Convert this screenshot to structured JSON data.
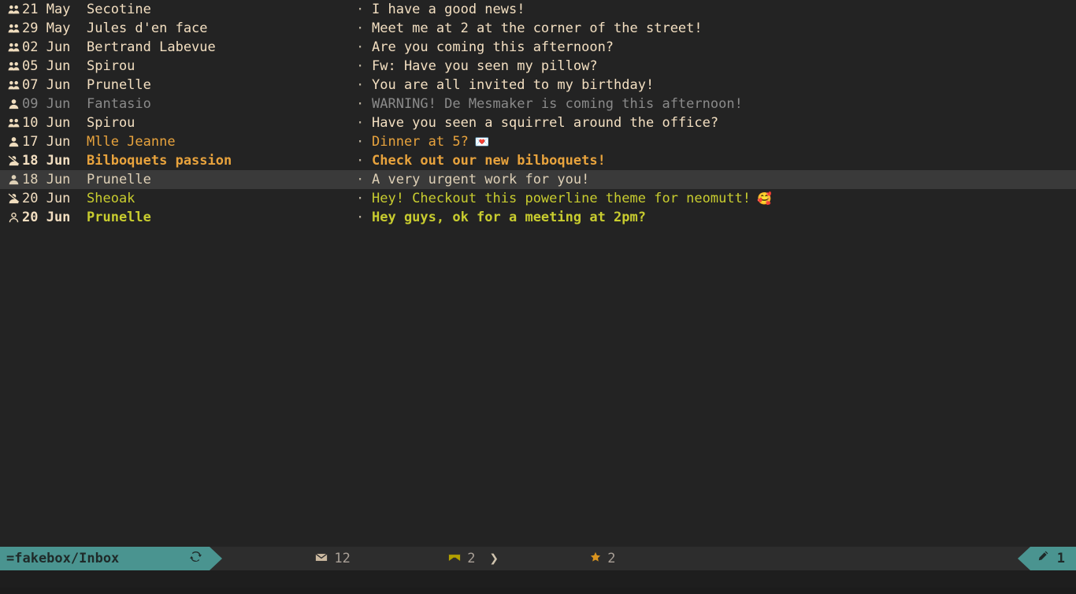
{
  "index": {
    "separator": "·",
    "rows": [
      {
        "flag_icon": "group-icon",
        "date": "21 May",
        "sender": "Secotine",
        "subject": "I have a good news!",
        "emoji": "",
        "style": "default",
        "selected": false
      },
      {
        "flag_icon": "group-icon",
        "date": "29 May",
        "sender": "Jules d'en face",
        "subject": "Meet me at 2 at the corner of the street!",
        "emoji": "",
        "style": "default",
        "selected": false
      },
      {
        "flag_icon": "group-icon",
        "date": "02 Jun",
        "sender": "Bertrand Labevue",
        "subject": "Are you coming this afternoon?",
        "emoji": "",
        "style": "default",
        "selected": false
      },
      {
        "flag_icon": "group-icon",
        "date": "05 Jun",
        "sender": "Spirou",
        "subject": "Fw: Have you seen my pillow?",
        "emoji": "",
        "style": "default",
        "selected": false
      },
      {
        "flag_icon": "group-icon",
        "date": "07 Jun",
        "sender": "Prunelle",
        "subject": "You are all invited to my birthday!",
        "emoji": "",
        "style": "default",
        "selected": false
      },
      {
        "flag_icon": "person-icon",
        "date": "09 Jun",
        "sender": "Fantasio",
        "subject": "WARNING! De Mesmaker is coming this afternoon!",
        "emoji": "",
        "style": "dim",
        "selected": false
      },
      {
        "flag_icon": "group-icon",
        "date": "10 Jun",
        "sender": "Spirou",
        "subject": "Have you seen a squirrel around the office?",
        "emoji": "",
        "style": "default",
        "selected": false
      },
      {
        "flag_icon": "person-icon",
        "date": "17 Jun",
        "sender": "Mlle Jeanne",
        "subject": "Dinner at 5?",
        "emoji": "💌",
        "style": "orange",
        "selected": false
      },
      {
        "flag_icon": "person-crossed-icon",
        "date": "18 Jun",
        "sender": "Bilboquets passion",
        "subject": "Check out our new bilboquets!",
        "emoji": "",
        "style": "orange-bold",
        "selected": false
      },
      {
        "flag_icon": "person-icon",
        "date": "18 Jun",
        "sender": "Prunelle",
        "subject": "A very urgent work for you!",
        "emoji": "",
        "style": "selected",
        "selected": true
      },
      {
        "flag_icon": "person-crossed-icon",
        "date": "20 Jun",
        "sender": "Sheoak",
        "subject": "Hey! Checkout this powerline theme for neomutt!",
        "emoji": "🥰",
        "style": "olive",
        "selected": false
      },
      {
        "flag_icon": "person-outline-icon",
        "date": "20 Jun",
        "sender": "Prunelle",
        "subject": "Hey guys, ok for a meeting at 2pm?",
        "emoji": "",
        "style": "olive-bold",
        "selected": false
      }
    ]
  },
  "statusbar": {
    "mailbox": "=fakebox/Inbox",
    "sync_icon": "refresh-icon",
    "total_icon": "envelope-icon",
    "total_count": "12",
    "new_icon": "envelope-new-icon",
    "new_count": "2",
    "chevron": "❯",
    "flagged_icon": "star-icon",
    "flagged_count": "2",
    "compose_icon": "pencil-icon",
    "compose_count": "1"
  },
  "colors": {
    "background": "#232323",
    "statusbar_background": "#2d2d2d",
    "accent_teal": "#4a9490",
    "text_default": "#f3dfc1",
    "text_dim": "#8a8a8a",
    "text_orange": "#e8a33d",
    "text_olive": "#c8cc2f",
    "selected_row": "#3a3a3a"
  }
}
